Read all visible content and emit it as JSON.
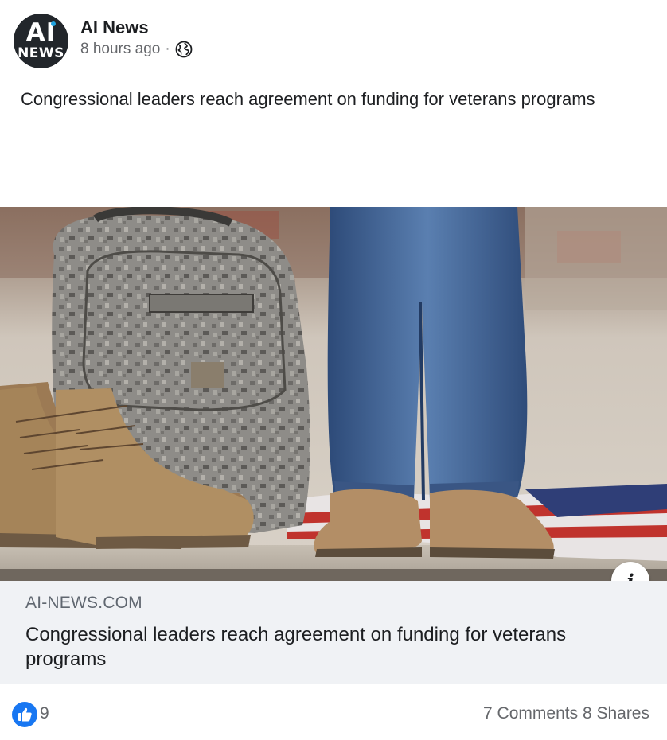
{
  "post": {
    "page_name": "AI News",
    "timestamp": "8 hours ago",
    "separator": "·",
    "audience_icon": "globe-icon",
    "text": "Congressional leaders reach agreement on funding for veterans programs"
  },
  "avatar": {
    "line1": "AI",
    "line2": "NEWS",
    "accent_color": "#1fa3e0"
  },
  "link_preview": {
    "domain": "AI-NEWS.COM",
    "title": "Congressional leaders reach agreement on funding for veterans programs",
    "info_icon": "info-icon",
    "info_label": "i"
  },
  "reactions": {
    "icon": "thumbs-up-icon",
    "count": "9",
    "color": "#1877f2"
  },
  "engagement": {
    "comments": "7 Comments",
    "shares": "8 Shares"
  }
}
